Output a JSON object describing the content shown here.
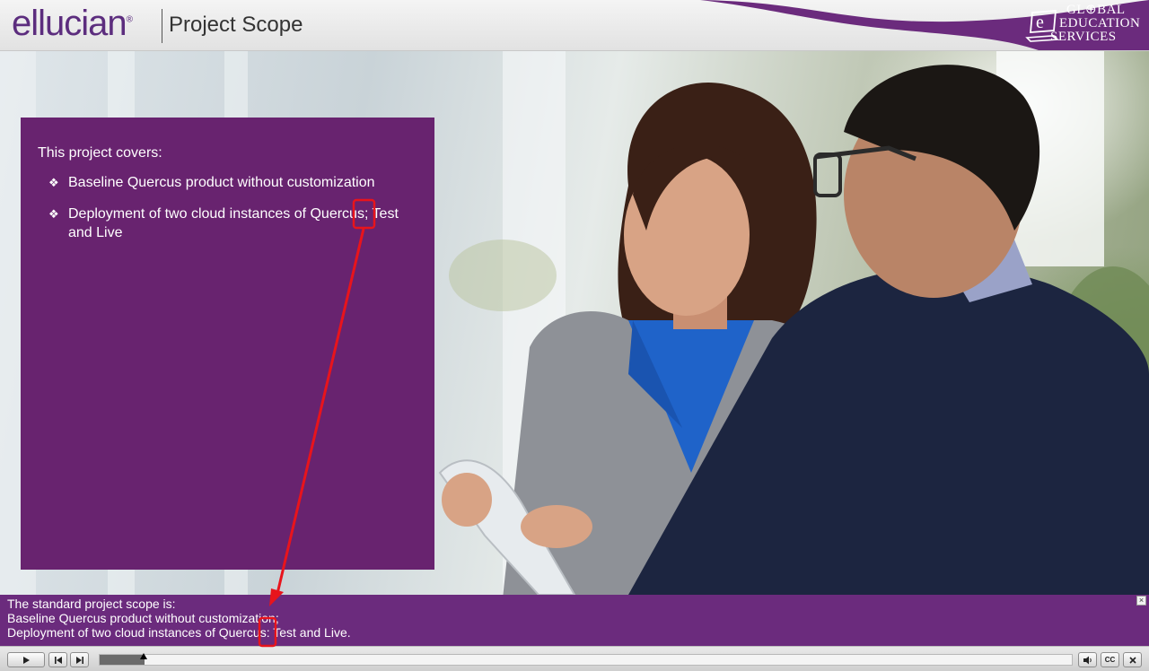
{
  "header": {
    "logo_text": "ellucian",
    "logo_mark": "®",
    "title": "Project Scope",
    "brand_logo": {
      "icon": "e-laptop-logo-icon",
      "line1": "GL⊕BAL",
      "line2": "EDUCATION",
      "line3": "SERVICES"
    }
  },
  "panel": {
    "intro": "This project covers:",
    "bullet_symbol": "❖",
    "bullets": [
      "Baseline Quercus product without customization",
      "Deployment of two cloud instances of Quercus; Test and Live"
    ]
  },
  "caption": {
    "lines": [
      "The standard project scope is:",
      "Baseline Quercus product without customization;",
      "Deployment of two cloud instances of Quercus: Test and Live."
    ],
    "close_symbol": "×"
  },
  "player": {
    "progress": 0.046,
    "icons": [
      "play-icon",
      "rewind-icon",
      "forward-icon",
      "volume-icon",
      "closed-captions-icon",
      "close-icon"
    ],
    "cc_label": "CC"
  },
  "colors": {
    "brand_purple": "#68236f",
    "caption_purple": "#6b2b7d",
    "annotation_red": "#e8141c"
  }
}
